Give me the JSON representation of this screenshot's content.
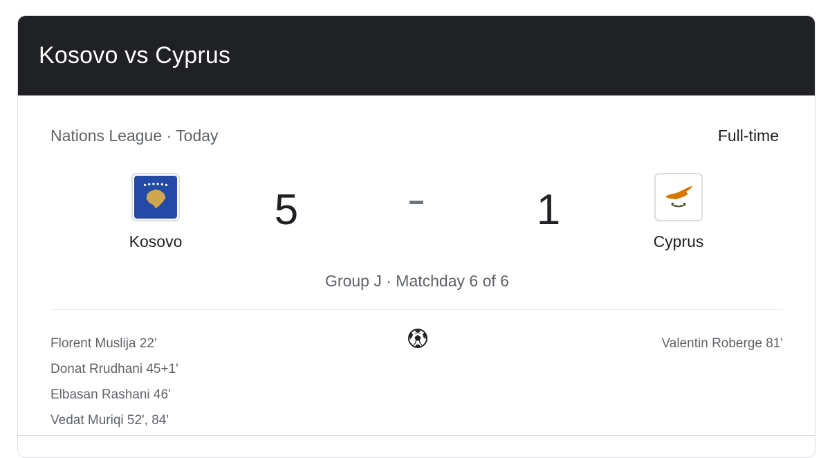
{
  "header": {
    "title": "Kosovo vs Cyprus"
  },
  "match": {
    "competition_line": "Nations League · Today",
    "status": "Full-time",
    "group_info": "Group J · Matchday 6 of 6"
  },
  "home_team": {
    "name": "Kosovo",
    "score": "5",
    "flag_icon": "kosovo-flag-icon",
    "flag_colors": {
      "background": "#244AA5",
      "map": "#D0A650",
      "stars": "#FFFFFF"
    },
    "scorers": [
      "Florent Muslija 22'",
      "Donat Rrudhani 45+1'",
      "Elbasan Rashani 46'",
      "Vedat Muriqi 52', 84'"
    ]
  },
  "away_team": {
    "name": "Cyprus",
    "score": "1",
    "flag_icon": "cyprus-flag-icon",
    "flag_colors": {
      "background": "#FFFFFF",
      "map": "#D57800",
      "branches": "#4E5B31"
    },
    "scorers": [
      "Valentin Roberge 81'"
    ]
  },
  "icons": {
    "goals": "soccer-ball-icon"
  },
  "colors": {
    "header_bg": "#202124",
    "primary_text": "#202124",
    "secondary_text": "#5f6368"
  }
}
